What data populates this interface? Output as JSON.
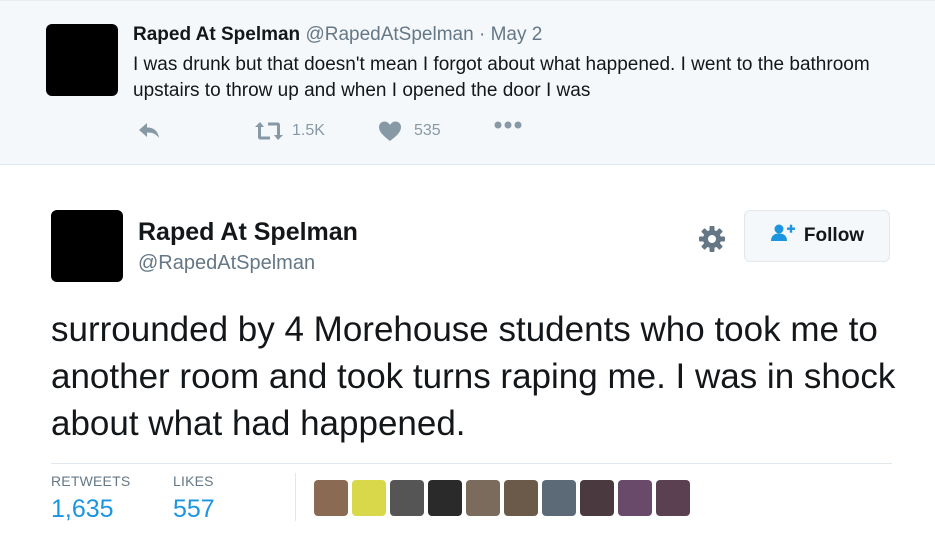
{
  "parent_tweet": {
    "name": "Raped At Spelman",
    "handle": "@RapedAtSpelman",
    "separator": "·",
    "date": "May 2",
    "text": "I was drunk but that doesn't mean I forgot about what happened. I went to the bathroom upstairs to throw up and when I opened the door I was",
    "actions": {
      "reply_icon": "reply-icon",
      "retweet_icon": "retweet-icon",
      "retweet_count": "1.5K",
      "like_icon": "heart-icon",
      "like_count": "535",
      "more_icon": "more-icon"
    }
  },
  "main_tweet": {
    "name": "Raped At Spelman",
    "handle": "@RapedAtSpelman",
    "settings_icon": "gear-icon",
    "follow_label": "Follow",
    "follow_icon": "follow-user-icon",
    "text": "surrounded by 4 Morehouse students who took me to another room and took turns raping me. I was in shock about what had happened.",
    "stats": {
      "retweets_label": "RETWEETS",
      "retweets_value": "1,635",
      "likes_label": "LIKES",
      "likes_value": "557"
    },
    "likers": [
      {
        "name": "liker-avatar-1",
        "color": "#8a6a52"
      },
      {
        "name": "liker-avatar-2",
        "color": "#d8d84a"
      },
      {
        "name": "liker-avatar-3",
        "color": "#555555"
      },
      {
        "name": "liker-avatar-4",
        "color": "#2a2a2a"
      },
      {
        "name": "liker-avatar-5",
        "color": "#7a6b5c"
      },
      {
        "name": "liker-avatar-6",
        "color": "#6b5a4a"
      },
      {
        "name": "liker-avatar-7",
        "color": "#5c6a78"
      },
      {
        "name": "liker-avatar-8",
        "color": "#4a3a40"
      },
      {
        "name": "liker-avatar-9",
        "color": "#6a4a6a"
      },
      {
        "name": "liker-avatar-10",
        "color": "#5a4050"
      }
    ]
  },
  "colors": {
    "link_blue": "#1b95e0",
    "muted_gray": "#657786",
    "icon_gray": "#8899a6",
    "parent_bg": "#f5f8fa"
  }
}
